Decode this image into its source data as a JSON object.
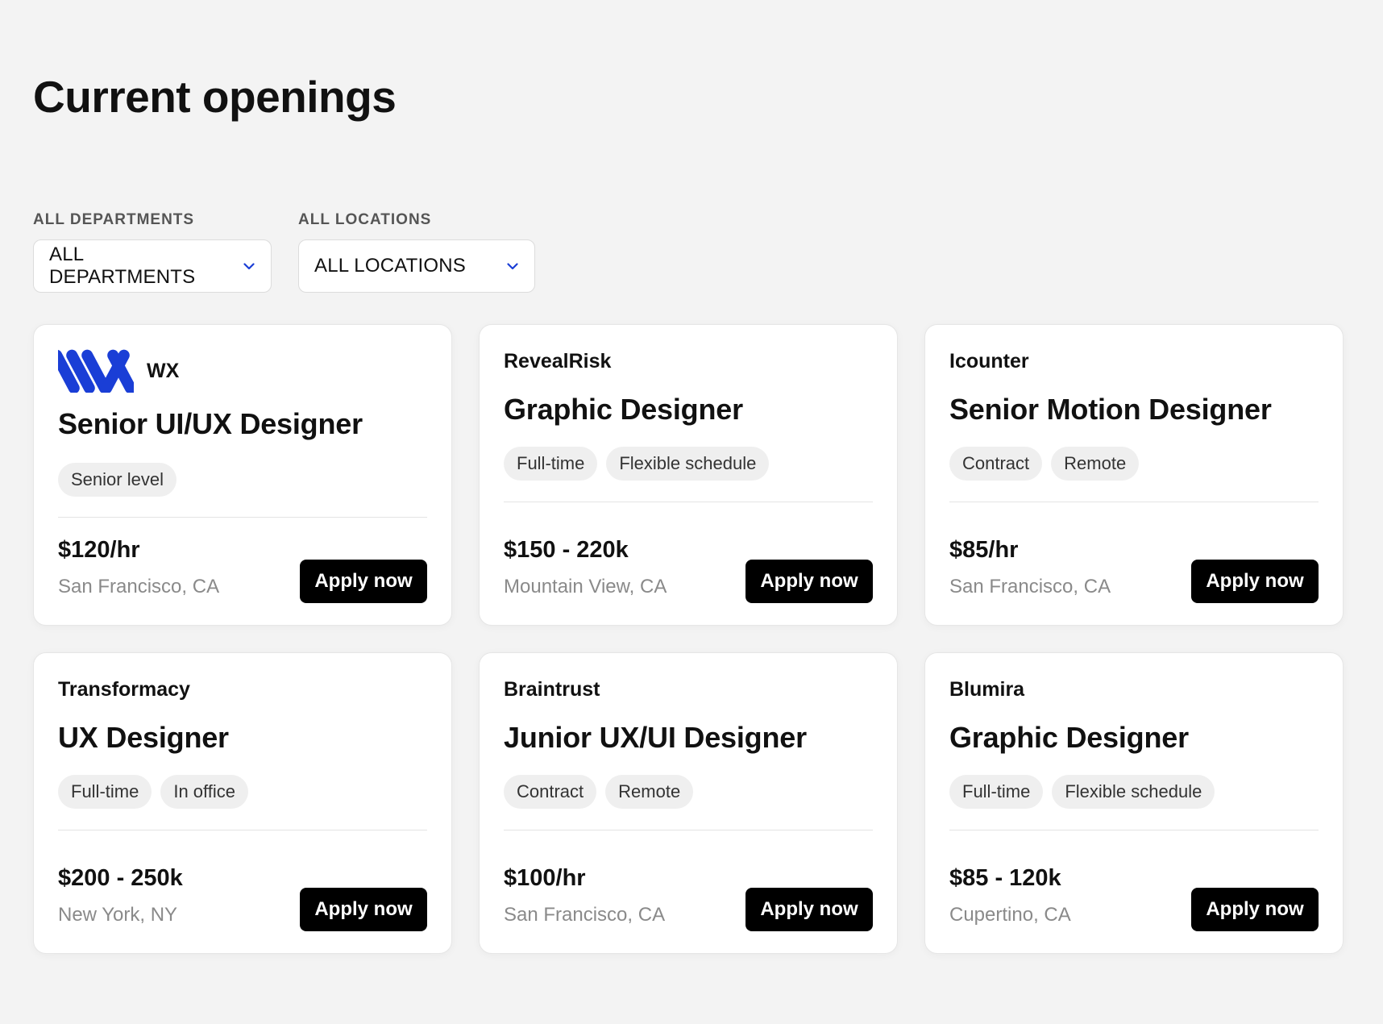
{
  "page": {
    "title": "Current openings"
  },
  "filters": {
    "departments": {
      "label": "ALL DEPARTMENTS",
      "value": "ALL DEPARTMENTS",
      "icon": "chevron-down-icon"
    },
    "locations": {
      "label": "ALL LOCATIONS",
      "value": "ALL LOCATIONS",
      "icon": "chevron-down-icon"
    }
  },
  "colors": {
    "accent": "#1a3ed6",
    "button_bg": "#000000",
    "background": "#f3f3f3"
  },
  "jobs": [
    {
      "company": "WX",
      "has_logo": true,
      "title": "Senior UI/UX Designer",
      "tags": [
        "Senior level"
      ],
      "salary": "$120/hr",
      "location": "San Francisco, CA",
      "cta": "Apply now"
    },
    {
      "company": "RevealRisk",
      "has_logo": false,
      "title": "Graphic Designer",
      "tags": [
        "Full-time",
        "Flexible schedule"
      ],
      "salary": "$150 - 220k",
      "location": "Mountain View, CA",
      "cta": "Apply now"
    },
    {
      "company": "Icounter",
      "has_logo": false,
      "title": "Senior Motion Designer",
      "tags": [
        "Contract",
        "Remote"
      ],
      "salary": "$85/hr",
      "location": "San Francisco, CA",
      "cta": "Apply now"
    },
    {
      "company": "Transformacy",
      "has_logo": false,
      "title": "UX Designer",
      "tags": [
        "Full-time",
        "In office"
      ],
      "salary": "$200 - 250k",
      "location": "New York, NY",
      "cta": "Apply now"
    },
    {
      "company": "Braintrust",
      "has_logo": false,
      "title": "Junior UX/UI Designer",
      "tags": [
        "Contract",
        "Remote"
      ],
      "salary": "$100/hr",
      "location": "San Francisco, CA",
      "cta": "Apply now"
    },
    {
      "company": "Blumira",
      "has_logo": false,
      "title": "Graphic Designer",
      "tags": [
        "Full-time",
        "Flexible schedule"
      ],
      "salary": "$85 - 120k",
      "location": "Cupertino, CA",
      "cta": "Apply now"
    }
  ]
}
